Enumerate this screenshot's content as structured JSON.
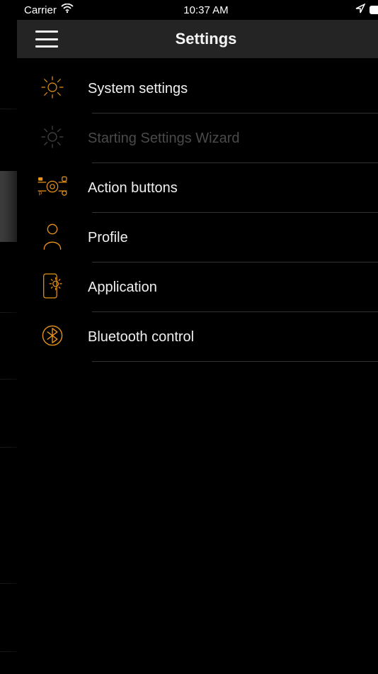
{
  "statusbar": {
    "carrier": "Carrier",
    "time": "10:37 AM"
  },
  "header": {
    "title": "Settings"
  },
  "colors": {
    "accent": "#e8941a",
    "header_bg": "#242424"
  },
  "rows": [
    {
      "label": "System settings",
      "icon": "gear-icon",
      "dim": false
    },
    {
      "label": "Starting Settings Wizard",
      "icon": "gear-icon",
      "dim": true
    },
    {
      "label": "Action buttons",
      "icon": "action-buttons-icon",
      "dim": false
    },
    {
      "label": "Profile",
      "icon": "profile-icon",
      "dim": false
    },
    {
      "label": "Application",
      "icon": "application-icon",
      "dim": false
    },
    {
      "label": "Bluetooth control",
      "icon": "bluetooth-icon",
      "dim": false
    }
  ]
}
